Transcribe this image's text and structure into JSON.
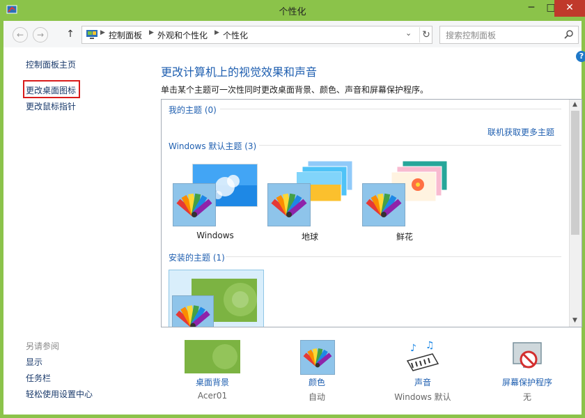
{
  "window": {
    "title": "个性化",
    "minimize": "─",
    "maximize": "□",
    "close": "✕"
  },
  "nav": {
    "back": "←",
    "forward": "→",
    "up": "↑",
    "breadcrumbs": [
      "控制面板",
      "外观和个性化",
      "个性化"
    ],
    "dropdown": "⌄",
    "refresh": "↻",
    "search_placeholder": "搜索控制面板"
  },
  "help": "?",
  "sidebar": {
    "home": "控制面板主页",
    "links": [
      "更改桌面图标",
      "更改鼠标指针"
    ],
    "see_also_heading": "另请参阅",
    "see_also": [
      "显示",
      "任务栏",
      "轻松使用设置中心"
    ]
  },
  "main": {
    "title": "更改计算机上的视觉效果和声音",
    "description": "单击某个主题可一次性同时更改桌面背景、颜色、声音和屏幕保护程序。",
    "my_themes": "我的主题 (0)",
    "online_link": "联机获取更多主题",
    "default_themes": "Windows 默认主题 (3)",
    "themes": [
      {
        "name": "Windows"
      },
      {
        "name": "地球"
      },
      {
        "name": "鲜花"
      }
    ],
    "installed_themes": "安装的主题 (1)"
  },
  "bottom": [
    {
      "label": "桌面背景",
      "value": "Acer01"
    },
    {
      "label": "颜色",
      "value": "自动"
    },
    {
      "label": "声音",
      "value": "Windows 默认"
    },
    {
      "label": "屏幕保护程序",
      "value": "无"
    }
  ],
  "colors": {
    "titlebar": "#8bc34a",
    "link": "#1f5fb0",
    "highlight": "#d81b1b"
  }
}
